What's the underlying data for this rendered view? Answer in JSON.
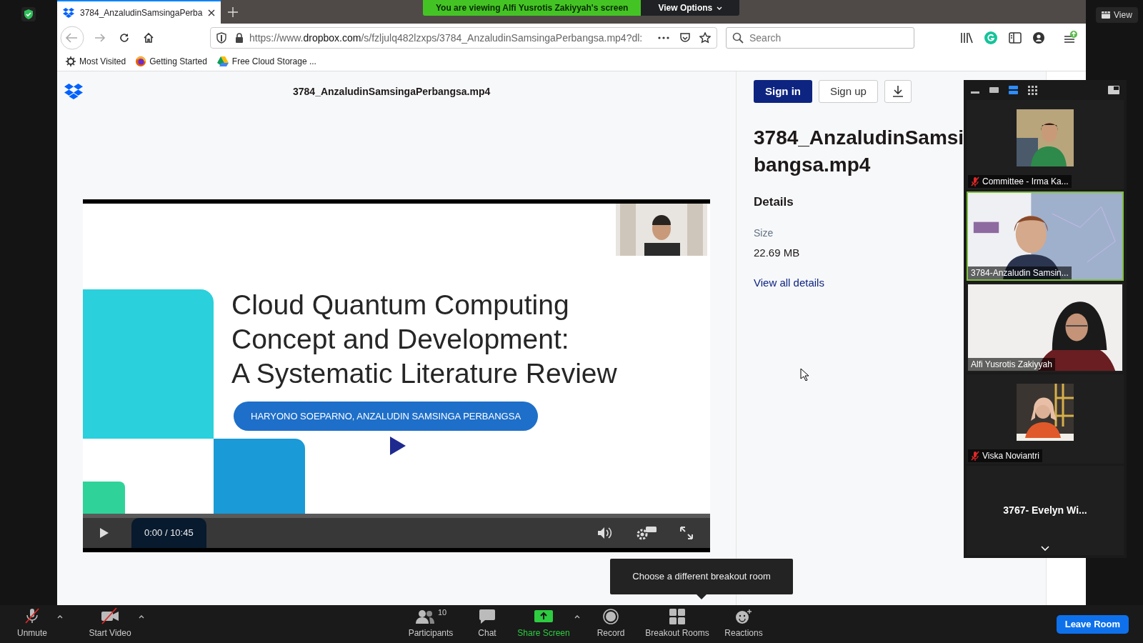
{
  "zoom_top": {
    "viewing_banner": "You are viewing Alfi Yusrotis Zakiyyah's screen",
    "view_options": "View Options",
    "view_button": "View"
  },
  "browser": {
    "tabs": [
      {
        "title": "3784_AnzaludinSamsingaPerba",
        "selected": true
      }
    ],
    "url": {
      "prefix": "https://www.",
      "domain": "dropbox.com",
      "rest": "/s/fzljulq482lzxps/3784_AnzaludinSamsingaPerbangsa.mp4?dl:"
    },
    "search": {
      "placeholder": "Search"
    },
    "bookmarks": [
      {
        "label": "Most Visited",
        "kind": "gear"
      },
      {
        "label": "Getting Started",
        "kind": "firefox"
      },
      {
        "label": "Free Cloud Storage ...",
        "kind": "drive"
      }
    ]
  },
  "page": {
    "file_title": "3784_AnzaludinSamsingaPerbangsa.mp4",
    "sign_in": "Sign in",
    "sign_up": "Sign up",
    "heading_lines": [
      "3784_AnzaludinSamsi",
      "bangsa.mp4"
    ],
    "details_label": "Details",
    "size_label": "Size",
    "size_value": "22.69 MB",
    "view_all": "View all details"
  },
  "video": {
    "slide": {
      "title_lines": [
        "Cloud Quantum Computing",
        "Concept and Development:",
        "A Systematic Literature Review"
      ],
      "authors": "HARYONO SOEPARNO, ANZALUDIN SAMSINGA PERBANGSA"
    },
    "time": "0:00 / 10:45"
  },
  "gallery": {
    "tiles": [
      {
        "name": "Committee - Irma Ka...",
        "muted": true,
        "active": false
      },
      {
        "name": "3784-Anzaludin Samsin...",
        "kind": "video",
        "muted": false,
        "active": true
      },
      {
        "name": "Alfi Yusrotis Zakiyyah",
        "kind": "video",
        "muted": false,
        "active": false
      },
      {
        "name": "Viska Noviantri",
        "muted": true,
        "active": false
      },
      {
        "name": "3767- Evelyn Wi...",
        "kind": "name_only",
        "muted": false,
        "active": false
      }
    ]
  },
  "tooltip": "Choose a different breakout room",
  "toolbar": {
    "left": [
      {
        "label": "Unmute",
        "kind": "mic"
      },
      {
        "label": "Start Video",
        "kind": "camera"
      }
    ],
    "center": [
      {
        "label": "Participants",
        "kind": "participants",
        "count": "10"
      },
      {
        "label": "Chat",
        "kind": "chat"
      },
      {
        "label": "Share Screen",
        "kind": "share"
      },
      {
        "label": "Record",
        "kind": "record"
      },
      {
        "label": "Breakout Rooms",
        "kind": "rooms"
      },
      {
        "label": "Reactions",
        "kind": "reactions"
      }
    ],
    "leave": "Leave Room"
  }
}
